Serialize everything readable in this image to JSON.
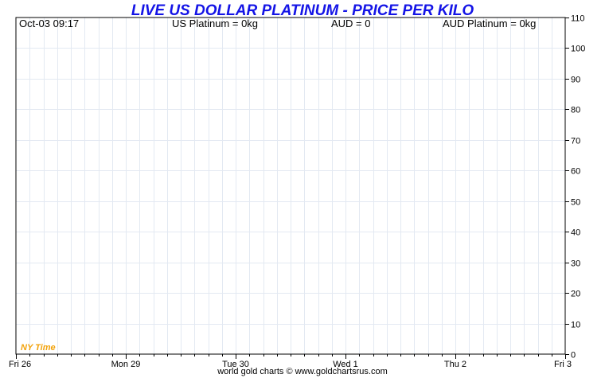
{
  "title": "LIVE US DOLLAR PLATINUM - PRICE PER KILO",
  "header": {
    "datetime": "Oct-03  09:17",
    "us_platinum": "US Platinum = 0kg",
    "aud": "AUD = 0",
    "aud_platinum": "AUD Platinum = 0kg"
  },
  "timezone_label": "NY Time",
  "footer": "world gold charts © www.goldchartsrus.com",
  "colors": {
    "title": "#1414e6",
    "timezone_label": "#f2a20a",
    "grid": "#e3e9f2",
    "axis": "#000000"
  },
  "chart_data": {
    "type": "line",
    "title": "LIVE US DOLLAR PLATINUM - PRICE PER KILO",
    "xlabel": "",
    "ylabel": "",
    "x_ticks": [
      "Fri 26",
      "Mon 29",
      "Tue 30",
      "Wed 1",
      "Thu 2",
      "Fri 3"
    ],
    "y_ticks": [
      "0",
      "10",
      "20",
      "30",
      "40",
      "50",
      "60",
      "70",
      "80",
      "90",
      "100",
      "110"
    ],
    "ylim": [
      0,
      110
    ],
    "grid": true,
    "series": []
  }
}
